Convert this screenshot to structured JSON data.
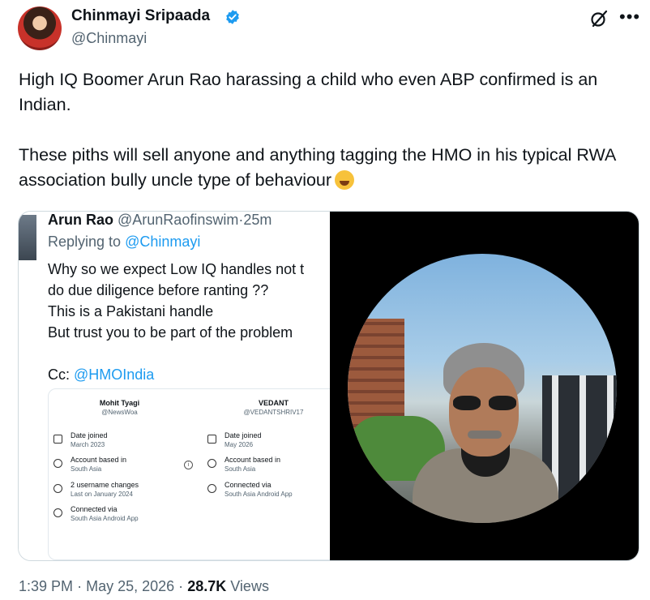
{
  "author": {
    "name": "Chinmayi Sripaada",
    "handle": "@Chinmayi",
    "verified": true
  },
  "tweet": {
    "line1": "High IQ Boomer Arun Rao harassing a child who even ABP confirmed is an Indian.",
    "line2": "These piths will sell anyone and anything tagging the HMO in his typical RWA association bully uncle type of behaviour",
    "emoji": "rolling-on-floor-laughing-emoji"
  },
  "quoted": {
    "name": "Arun Rao",
    "handle": "@ArunRaofinswim",
    "sep": "·",
    "time": "25m",
    "replying_to": "Replying to",
    "replying_handle": "@Chinmayi",
    "lines": [
      "Why so we expect Low IQ handles not  t",
      "do due diligence before ranting ??",
      "This is a Pakistani handle",
      "But trust you to be part of the problem"
    ],
    "cc_label": "Cc:",
    "cc_handle": "@HMOIndia"
  },
  "card": {
    "left": {
      "name": "Mohit Tyagi",
      "handle": "@NewsWoa",
      "rows": [
        {
          "title": "Date joined",
          "sub": "March 2023"
        },
        {
          "title": "Account based in",
          "sub": "South Asia"
        },
        {
          "title": "2 username changes",
          "sub": "Last on January 2024"
        },
        {
          "title": "Connected via",
          "sub": "South Asia Android App"
        }
      ]
    },
    "right": {
      "name": "VEDANT",
      "handle": "@VEDANTSHRIV17",
      "rows": [
        {
          "title": "Date joined",
          "sub": "May 2026"
        },
        {
          "title": "Account based in",
          "sub": "South Asia"
        },
        {
          "title": "Connected via",
          "sub": "South Asia Android App"
        }
      ]
    },
    "info_symbol": "i"
  },
  "meta": {
    "time": "1:39 PM",
    "dot": "·",
    "date": "May 25, 2026",
    "views": "28.7K",
    "views_label": "Views"
  },
  "colors": {
    "link": "#1d9bf0",
    "verified": "#1d9bf0",
    "muted": "#536471"
  },
  "icons": {
    "verified": "verified-badge-icon",
    "grok": "grok-icon",
    "more": "more-icon"
  }
}
